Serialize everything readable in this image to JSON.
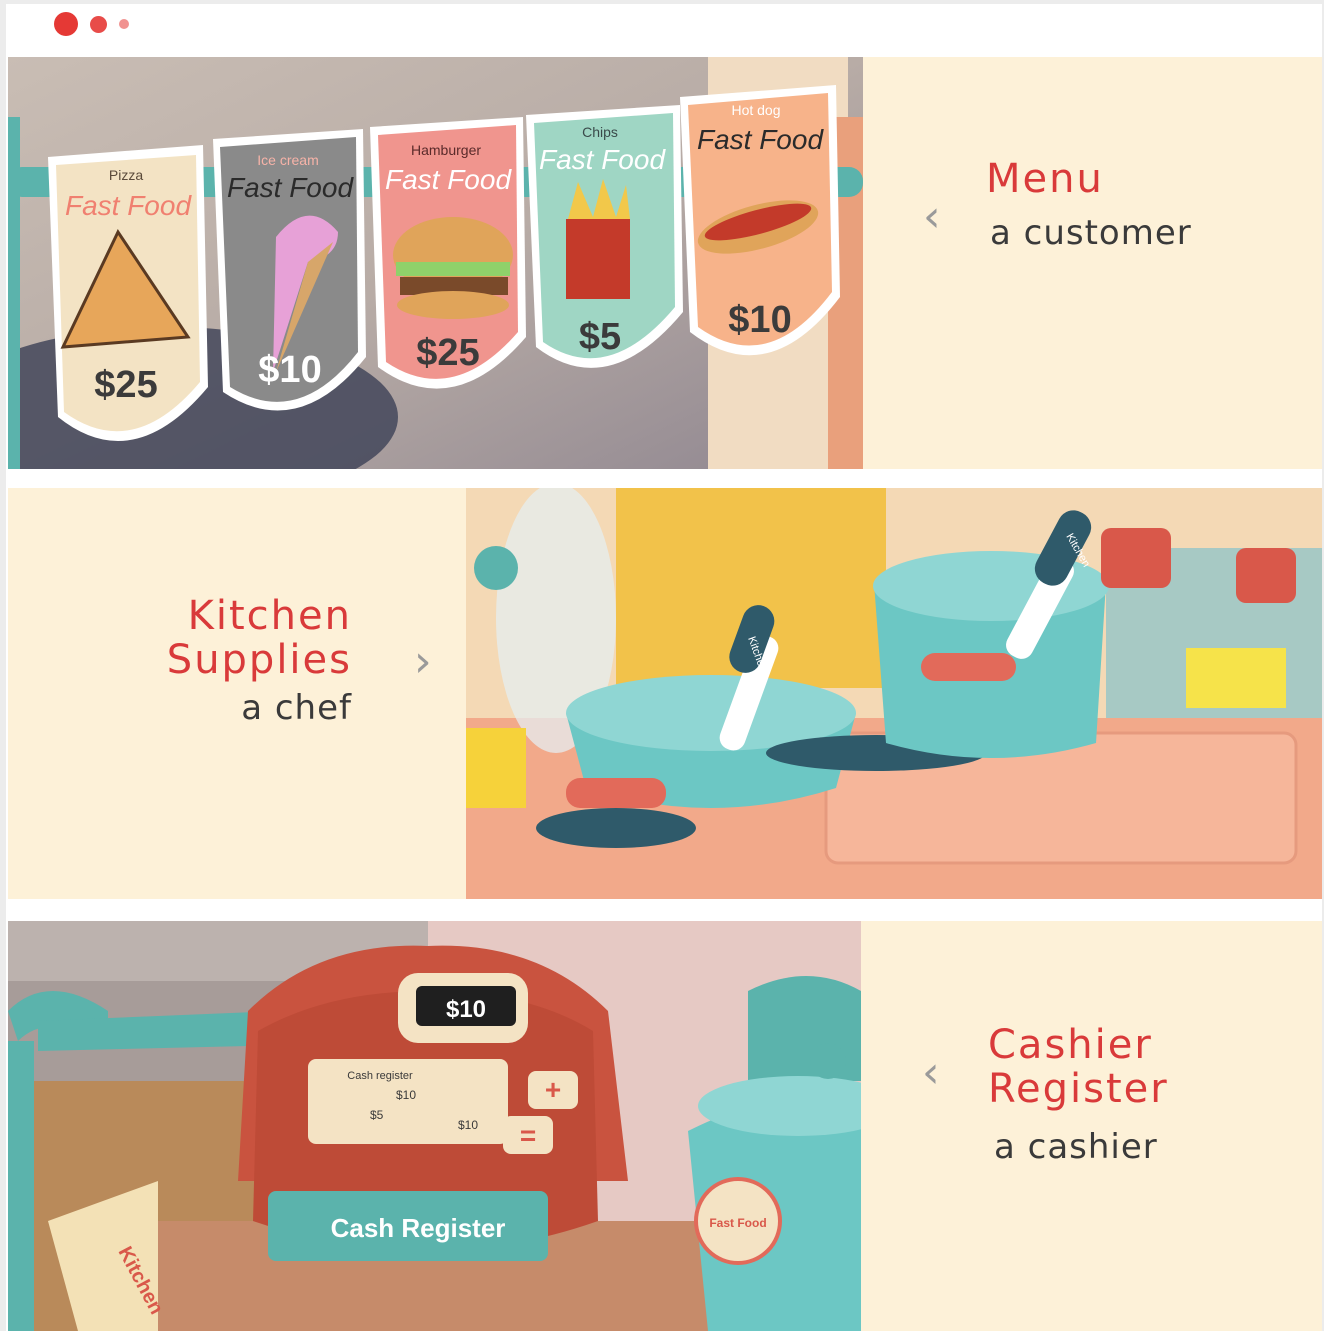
{
  "colors": {
    "accent": "#e53935",
    "cream": "#fdf1d8",
    "title_red": "#d93a3a",
    "text": "#3a3a3a"
  },
  "carousel_dots": [
    {
      "state": "active"
    },
    {
      "state": "inactive"
    },
    {
      "state": "inactive"
    }
  ],
  "panels": [
    {
      "title": [
        "Menu"
      ],
      "subtitle": "a customer",
      "arrow_icon": "chevron-left-icon",
      "arrow_glyph": "‹",
      "menu_cards": [
        {
          "category": "Pizza",
          "heading": "Fast Food",
          "price": "$25"
        },
        {
          "category": "Ice cream",
          "heading": "Fast Food",
          "price": "$10"
        },
        {
          "category": "Hamburger",
          "heading": "Fast Food",
          "price": "$25"
        },
        {
          "category": "Chips",
          "heading": "Fast Food",
          "price": "$5"
        },
        {
          "category": "Hot dog",
          "heading": "Fast Food",
          "price": "$10"
        }
      ]
    },
    {
      "title": [
        "Kitchen",
        "Supplies"
      ],
      "subtitle": "a chef",
      "arrow_icon": "chevron-right-icon",
      "arrow_glyph": "›",
      "handle_label": "Kitchen"
    },
    {
      "title": [
        "Cashier",
        "Register"
      ],
      "subtitle": "a cashier",
      "arrow_icon": "chevron-left-icon",
      "arrow_glyph": "‹",
      "register": {
        "display": "$10",
        "card_heading": "Cash register",
        "card_prices": [
          "$10",
          "$5",
          "$10"
        ],
        "plus_key": "+",
        "equals_key": "=",
        "label": "Cash Register",
        "side_label": "Kitchen",
        "badge": "Fast Food"
      }
    }
  ]
}
